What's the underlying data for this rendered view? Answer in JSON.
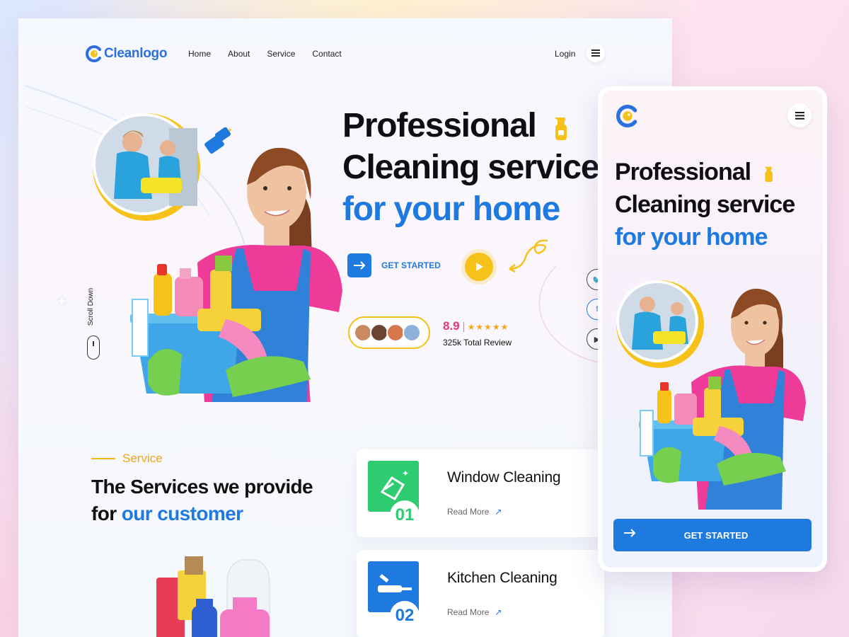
{
  "brand": {
    "name": "Cleanlogo",
    "color": "#2d6fdc",
    "accent": "#f6c21a"
  },
  "nav": {
    "items": [
      "Home",
      "About",
      "Service",
      "Contact"
    ],
    "login": "Login"
  },
  "hero": {
    "title_line1": "Professional",
    "title_line2": "Cleaning service",
    "title_line3": "for your home",
    "cta_label": "GET STARTED",
    "rating": "8.9",
    "stars": "★★★★★",
    "reviews": "325k Total Review",
    "scroll_label": "Scroll Down",
    "social_icons": [
      "twitter-icon",
      "facebook-icon",
      "youtube-icon"
    ]
  },
  "services": {
    "tag": "Service",
    "heading_line1": "The Services we provide",
    "heading_line2_prefix": "for ",
    "heading_line2_highlight": "our customer",
    "cards": [
      {
        "number": "01",
        "title": "Window Cleaning",
        "link": "Read More",
        "icon": "window-cleaning-icon",
        "color": "#2ecc71"
      },
      {
        "number": "02",
        "title": "Kitchen Cleaning",
        "link": "Read More",
        "icon": "kitchen-cleaning-icon",
        "color": "#1f7ae0"
      }
    ]
  },
  "mobile": {
    "title_line1": "Professional",
    "title_line2": "Cleaning service",
    "title_line3": "for your home",
    "cta_label": "GET STARTED"
  }
}
